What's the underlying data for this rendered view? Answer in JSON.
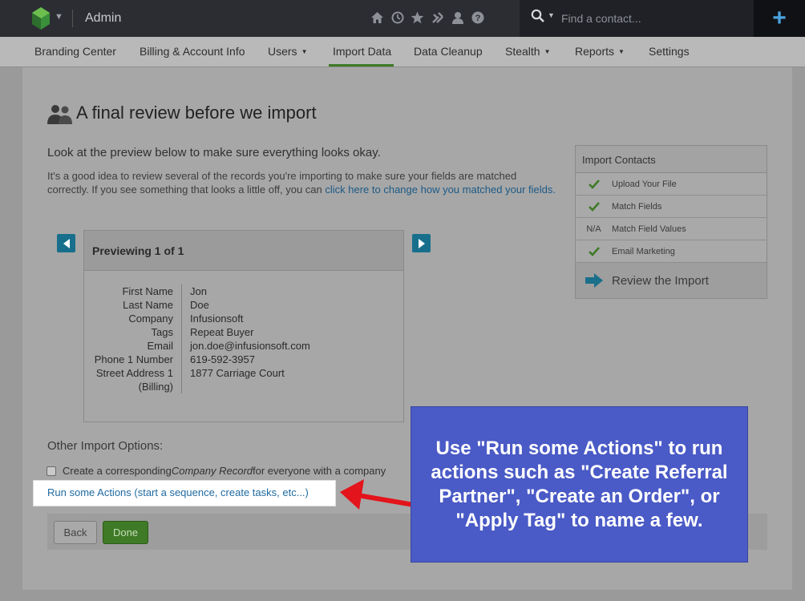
{
  "topbar": {
    "title": "Admin",
    "search_placeholder": "Find a contact...",
    "plus_label": "+",
    "icons": [
      "home-icon",
      "clock-icon",
      "star-icon",
      "tools-icon",
      "person-icon",
      "help-icon"
    ]
  },
  "nav": {
    "items": [
      {
        "label": "Branding Center",
        "caret": ""
      },
      {
        "label": "Billing & Account Info",
        "caret": ""
      },
      {
        "label": "Users",
        "caret": "▼"
      },
      {
        "label": "Import Data",
        "caret": ""
      },
      {
        "label": "Data Cleanup",
        "caret": ""
      },
      {
        "label": "Stealth",
        "caret": "▼"
      },
      {
        "label": "Reports",
        "caret": "▼"
      },
      {
        "label": "Settings",
        "caret": ""
      }
    ],
    "active": "Import Data"
  },
  "page": {
    "title": "A final review before we import",
    "intro": "Look at the preview below to make sure everything looks okay.",
    "desc_before": "It's a good idea to review several of the records you're importing to make sure your fields are matched correctly. If you see something that looks a little off, you can ",
    "desc_link": "click here to change how you matched your fields."
  },
  "preview": {
    "heading": "Previewing 1 of 1",
    "fields": [
      {
        "label": "First Name",
        "value": "Jon"
      },
      {
        "label": "Last Name",
        "value": "Doe"
      },
      {
        "label": "Company",
        "value": "Infusionsoft"
      },
      {
        "label": "Tags",
        "value": "Repeat Buyer"
      },
      {
        "label": "Email",
        "value": "jon.doe@infusionsoft.com"
      },
      {
        "label": "Phone 1 Number",
        "value": "619-592-3957"
      },
      {
        "label": "Street Address 1 (Billing)",
        "value": "1877 Carriage Court"
      }
    ]
  },
  "steps": {
    "heading": "Import Contacts",
    "items": [
      {
        "mark": "check",
        "label": "Upload Your File"
      },
      {
        "mark": "check",
        "label": "Match Fields"
      },
      {
        "mark": "N/A",
        "label": "Match Field Values"
      },
      {
        "mark": "check",
        "label": "Email Marketing"
      }
    ],
    "current": "Review the Import",
    "colors": {
      "check": "#3f7a27",
      "current_arrow": "#1a6f8a"
    }
  },
  "options": {
    "heading": "Other Import Options:",
    "checkbox_before": "Create a corresponding ",
    "checkbox_em": "Company Record",
    "checkbox_after": " for everyone with a company",
    "actions_link": "Run some Actions (start a sequence, create tasks, etc...)"
  },
  "buttons": {
    "back": "Back",
    "done": "Done"
  },
  "callout": {
    "text": "Use \"Run some Actions\" to run actions such as \"Create Referral Partner\", \"Create an Order\", or \"Apply Tag\" to name a few.",
    "bg": "#4a5ac6",
    "arrow_color": "#e3141b"
  }
}
